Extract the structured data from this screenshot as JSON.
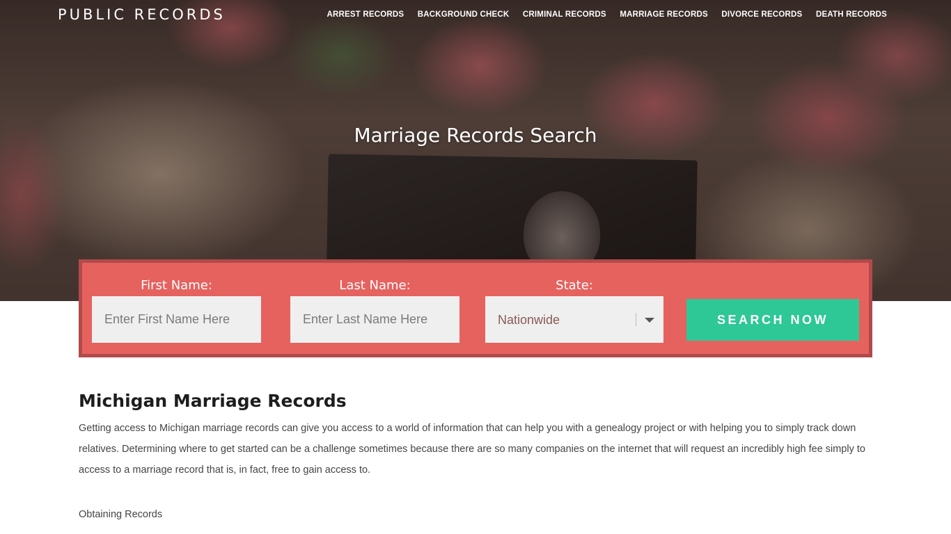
{
  "site": {
    "logo": "PUBLIC RECORDS"
  },
  "nav": {
    "items": [
      {
        "label": "ARREST RECORDS"
      },
      {
        "label": "BACKGROUND CHECK"
      },
      {
        "label": "CRIMINAL RECORDS"
      },
      {
        "label": "MARRIAGE RECORDS"
      },
      {
        "label": "DIVORCE RECORDS"
      },
      {
        "label": "DEATH RECORDS"
      }
    ]
  },
  "hero": {
    "title": "Marriage Records Search"
  },
  "search": {
    "first_name_label": "First Name:",
    "first_name_placeholder": "Enter First Name Here",
    "first_name_value": "",
    "last_name_label": "Last Name:",
    "last_name_placeholder": "Enter Last Name Here",
    "last_name_value": "",
    "state_label": "State:",
    "state_selected": "Nationwide",
    "button_label": "SEARCH NOW"
  },
  "article": {
    "heading": "Michigan Marriage Records",
    "paragraph": "Getting access to Michigan marriage records can give you access to a world of information that can help you with a genealogy project or with helping you to simply track down relatives. Determining where to get started can be a challenge sometimes because there are so many companies on the internet that will request an incredibly high fee simply to access to a marriage record that is, in fact, free to gain access to.",
    "subheading": "Obtaining Records"
  },
  "colors": {
    "panel": "#e5625f",
    "panel_border": "#b24a4a",
    "button": "#2ec796"
  }
}
